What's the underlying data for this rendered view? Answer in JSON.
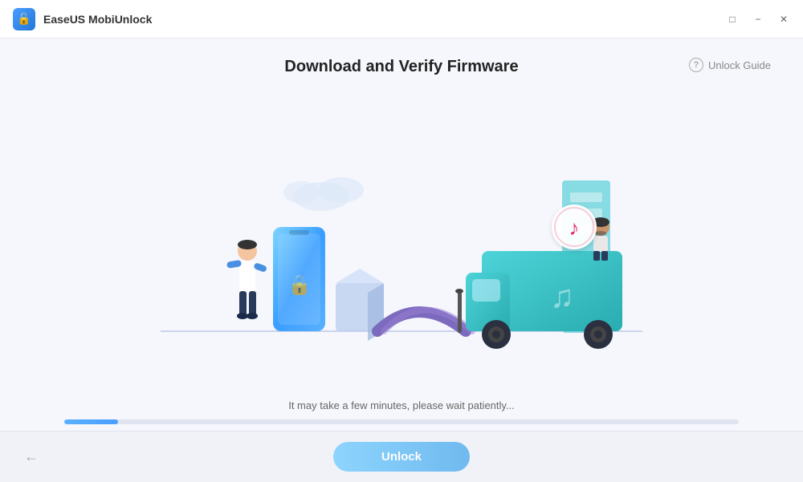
{
  "app": {
    "title": "EaseUS MobiUnlock",
    "icon_symbol": "🔓"
  },
  "window_controls": {
    "minimize_label": "−",
    "maximize_label": "□",
    "close_label": "✕"
  },
  "header": {
    "page_title": "Download and Verify Firmware",
    "unlock_guide_label": "Unlock Guide"
  },
  "progress": {
    "status_text": "It may take a few minutes, please wait patiently...",
    "percent": 8
  },
  "footer": {
    "back_icon": "←",
    "unlock_button_label": "Unlock"
  }
}
